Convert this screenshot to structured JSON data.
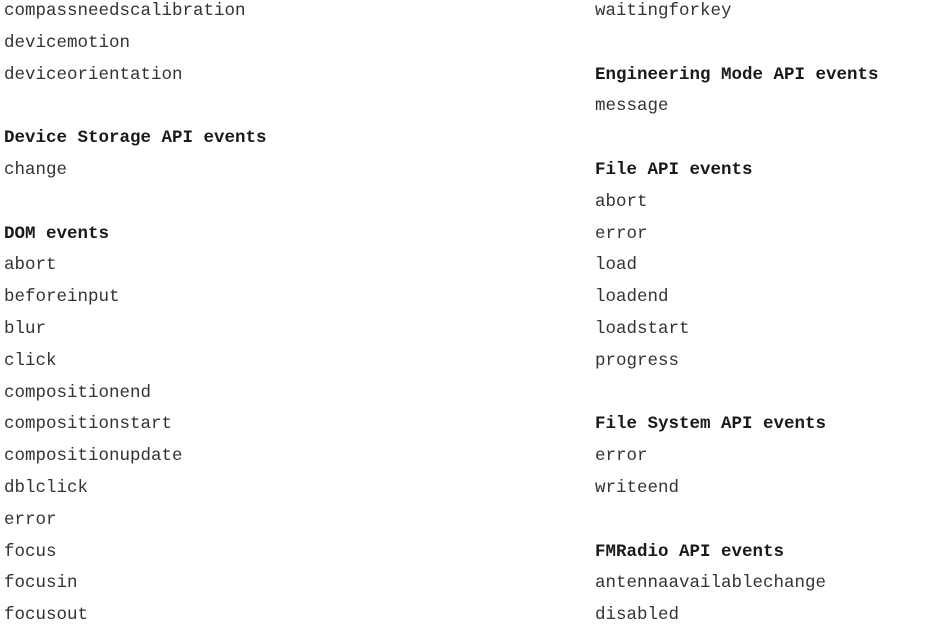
{
  "left_column": {
    "sections": [
      {
        "heading": "",
        "items": [
          "compassneedscalibration",
          "devicemotion",
          "deviceorientation"
        ]
      },
      {
        "heading": "Device Storage API events",
        "items": [
          "change"
        ]
      },
      {
        "heading": "DOM events",
        "items": [
          "abort",
          "beforeinput",
          "blur",
          "click",
          "compositionend",
          "compositionstart",
          "compositionupdate",
          "dblclick",
          "error",
          "focus",
          "focusin",
          "focusout"
        ]
      }
    ]
  },
  "right_column": {
    "sections": [
      {
        "heading": "",
        "items": [
          "waitingforkey"
        ]
      },
      {
        "heading": "Engineering Mode API events",
        "items": [
          "message"
        ]
      },
      {
        "heading": "File API events",
        "items": [
          "abort",
          "error",
          "load",
          "loadend",
          "loadstart",
          "progress"
        ]
      },
      {
        "heading": "File System API events",
        "items": [
          "error",
          "writeend"
        ]
      },
      {
        "heading": "FMRadio API events",
        "items": [
          "antennaavailablechange",
          "disabled"
        ]
      }
    ]
  }
}
